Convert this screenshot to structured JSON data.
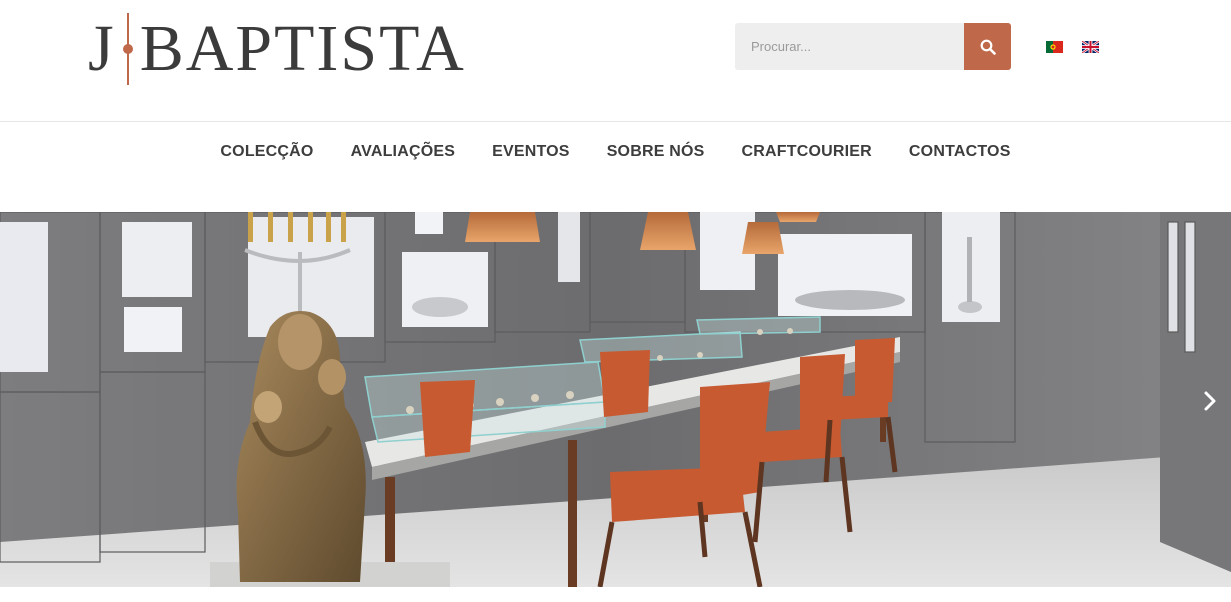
{
  "brand": {
    "logo_j": "J",
    "logo_rest": "BAPTISTA",
    "accent_color": "#c0694a"
  },
  "search": {
    "placeholder": "Procurar...",
    "button_icon": "search-icon"
  },
  "languages": [
    {
      "code": "pt",
      "icon": "flag-portugal-icon"
    },
    {
      "code": "en",
      "icon": "flag-uk-icon"
    }
  ],
  "nav": {
    "items": [
      {
        "label": "COLECÇÃO"
      },
      {
        "label": "AVALIAÇÕES"
      },
      {
        "label": "EVENTOS"
      },
      {
        "label": "SOBRE NÓS"
      },
      {
        "label": "CRAFTCOURIER"
      },
      {
        "label": "CONTACTOS"
      }
    ]
  },
  "hero": {
    "image": "showroom-photo",
    "next_icon": "chevron-right-icon"
  }
}
